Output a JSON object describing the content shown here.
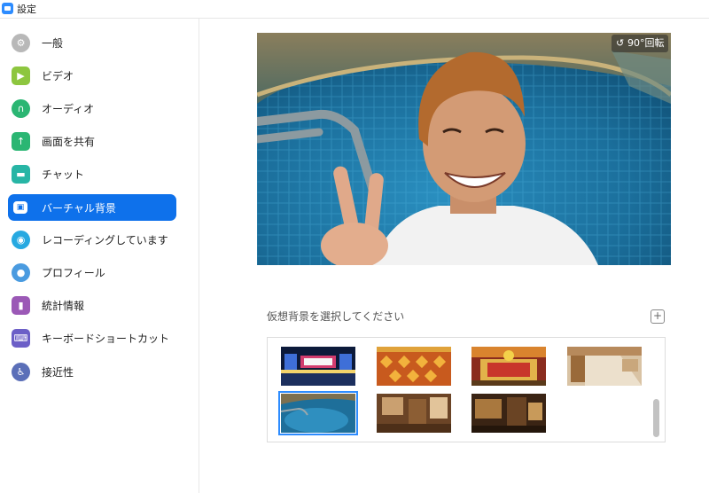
{
  "window": {
    "title": "設定"
  },
  "sidebar": {
    "items": [
      {
        "label": "一般",
        "color": "#b0b0b0",
        "glyph": "⚙"
      },
      {
        "label": "ビデオ",
        "color": "#8dc63f",
        "glyph": "▶"
      },
      {
        "label": "オーディオ",
        "color": "#2bb673",
        "glyph": "∩"
      },
      {
        "label": "画面を共有",
        "color": "#2bb673",
        "glyph": "↑"
      },
      {
        "label": "チャット",
        "color": "#27b5a5",
        "glyph": "▬"
      },
      {
        "label": "バーチャル背景",
        "color": "#0e71eb",
        "glyph": "▣"
      },
      {
        "label": "レコーディングしています",
        "color": "#27a9e1",
        "glyph": "◉"
      },
      {
        "label": "プロフィール",
        "color": "#4a9be0",
        "glyph": "●"
      },
      {
        "label": "統計情報",
        "color": "#9b59b6",
        "glyph": "▮"
      },
      {
        "label": "キーボードショートカット",
        "color": "#6c5fc7",
        "glyph": "⌨"
      },
      {
        "label": "接近性",
        "color": "#5b6fb8",
        "glyph": "♿"
      }
    ],
    "active_index": 5
  },
  "preview": {
    "rotate_label": "90°回転"
  },
  "virtual_background": {
    "title": "仮想背景を選択してください",
    "add_glyph": "+",
    "thumbnails": [
      {
        "name": "stage",
        "selected": false
      },
      {
        "name": "orange-pattern",
        "selected": false
      },
      {
        "name": "festival",
        "selected": false
      },
      {
        "name": "room",
        "selected": false
      },
      {
        "name": "pool",
        "selected": true
      },
      {
        "name": "wooden-interior",
        "selected": false
      },
      {
        "name": "dark-interior",
        "selected": false
      }
    ]
  },
  "colors": {
    "accent": "#0e71eb"
  }
}
